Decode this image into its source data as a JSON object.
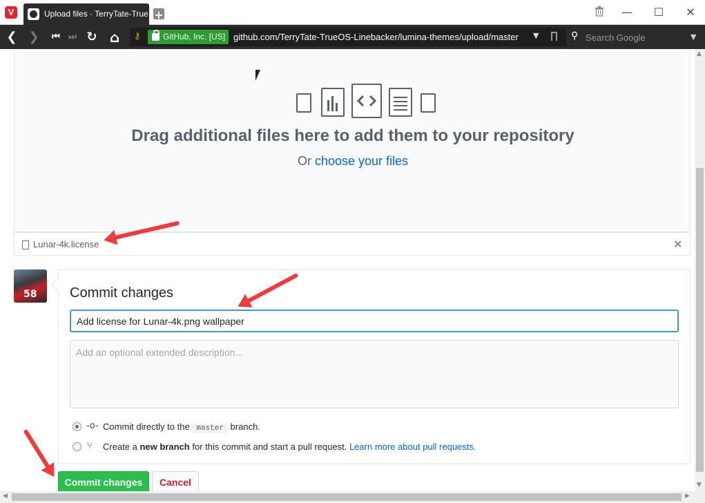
{
  "browser": {
    "logo": "V",
    "tab_title": "Upload files · TerryTate-TrueOS",
    "new_tab": "+",
    "trash_icon": "trash-icon",
    "minimize": "—",
    "maximize": "☐",
    "close": "✕"
  },
  "addressbar": {
    "back": "❮",
    "forward": "❯",
    "first": "⏮",
    "last": "⏭",
    "reload": "↻",
    "home": "⌂",
    "cert_label": "GitHub, Inc. [US]",
    "url": "github.com/TerryTate-TrueOS-Linebacker/lumina-themes/upload/master",
    "url_dropdown": "▼",
    "search_placeholder": "Search Google",
    "search_dropdown": "▼"
  },
  "dropzone": {
    "title": "Drag additional files here to add them to your repository",
    "or_text": "Or ",
    "choose_link": "choose your files"
  },
  "uploaded_file": {
    "name": "Lunar-4k.license",
    "remove": "✕"
  },
  "avatar": {
    "jersey_number": "58"
  },
  "commit": {
    "heading": "Commit changes",
    "summary_value": "Add license for Lunar-4k.png wallpaper",
    "description_placeholder": "Add an optional extended description...",
    "option_direct": {
      "prefix": "Commit directly to the ",
      "branch": "master",
      "suffix": " branch.",
      "checked": true
    },
    "option_new_branch": {
      "prefix": "Create a ",
      "bold": "new branch",
      "middle": " for this commit and start a pull request. ",
      "link": "Learn more about pull requests.",
      "checked": false
    },
    "submit_label": "Commit changes",
    "cancel_label": "Cancel"
  },
  "annotation_color": "#ee3b3b",
  "accent_color": "#2cbe4e",
  "link_color": "#0366d6"
}
